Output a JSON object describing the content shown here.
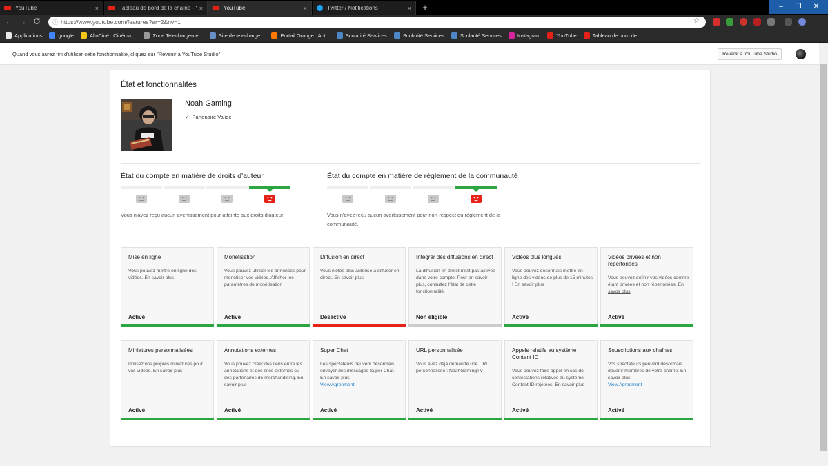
{
  "browser": {
    "tabs": [
      {
        "label": "YouTube",
        "icon": "youtube-icon",
        "close": "×"
      },
      {
        "label": "Tableau de bord de la chaîne - Y",
        "icon": "youtube-icon",
        "close": "×"
      },
      {
        "label": "YouTube",
        "icon": "youtube-icon",
        "close": "×"
      },
      {
        "label": "Twitter / Notifications",
        "icon": "twitter-icon",
        "close": "×"
      }
    ],
    "new_tab": "+",
    "window_controls": [
      "–",
      "❐",
      "✕"
    ],
    "url": "https://www.youtube.com/features?ar=2&nv=1",
    "back": "←",
    "forward": "→",
    "reload": "C",
    "star": "☆",
    "bookmarks": [
      {
        "label": "Applications",
        "color": "#e8e8e8"
      },
      {
        "label": "google",
        "color": "#4285f4"
      },
      {
        "label": "AlloCiné : Cinéma,...",
        "color": "#f5c518"
      },
      {
        "label": "Zone Telechargeme...",
        "color": "#999999"
      },
      {
        "label": "Site de telecharge...",
        "color": "#6a8ec7"
      },
      {
        "label": "Portail Orange : Act...",
        "color": "#ff7900"
      },
      {
        "label": "Scolarité Services",
        "color": "#4d87c7"
      },
      {
        "label": "Scolarité Services",
        "color": "#4d87c7"
      },
      {
        "label": "Scolarité Services",
        "color": "#4d87c7"
      },
      {
        "label": "Instagram",
        "color": "#d6249f"
      },
      {
        "label": "YouTube",
        "color": "#e62117"
      },
      {
        "label": "Tableau de bord de...",
        "color": "#e62117"
      }
    ]
  },
  "notice": {
    "text": "Quand vous aurez fini d'utiliser cette fonctionnalité, cliquez sur \"Revenir à YouTube Studio\"",
    "button": "Revenir à YouTube Studio"
  },
  "panel": {
    "title": "État et fonctionnalités",
    "channel_name": "Noah Gaming",
    "verified_label": "Partenaire Validé",
    "verified_check": "✓"
  },
  "copyright": {
    "title": "État du compte en matière de droits d'auteur",
    "strikes_active": 0,
    "desc": "Vous n'avez reçu aucun avertissement pour atteinte aux droits d'auteur."
  },
  "community": {
    "title": "État du compte en matière de règlement de la communauté",
    "strikes_active": 0,
    "desc": "Vous n'avez reçu aucun avertissement pour non-respect du règlement de la communauté."
  },
  "colors": {
    "active": "#2ba640",
    "disabled": "#e62117",
    "ineligible": "#cccccc"
  },
  "cards_row1": [
    {
      "title": "Mise en ligne",
      "desc": "Vous pouvez mettre en ligne des vidéos. ",
      "link": "En savoir plus",
      "agree": "",
      "status": "Activé",
      "state": "active"
    },
    {
      "title": "Monétisation",
      "desc": "Vous pouvez utiliser les annonces pour monétiser vos vidéos. ",
      "link": "Afficher les paramètres de monétisation",
      "agree": "",
      "status": "Activé",
      "state": "active"
    },
    {
      "title": "Diffusion en direct",
      "desc": "Vous n'êtes plus autorisé à diffuser en direct. ",
      "link": "En savoir plus",
      "agree": "",
      "status": "Désactivé",
      "state": "disabled"
    },
    {
      "title": "Intégrer des diffusions en direct",
      "desc": "La diffusion en direct n'est pas activée dans votre compte. Pour en savoir plus, consultez l'état de cette fonctionnalité.",
      "link": "",
      "agree": "",
      "status": "Non éligible",
      "state": "ineligible"
    },
    {
      "title": "Vidéos plus longues",
      "desc": "Vous pouvez désormais mettre en ligne des vidéos de plus de 15 minutes ! ",
      "link": "En savoir plus",
      "agree": "",
      "status": "Activé",
      "state": "active"
    },
    {
      "title": "Vidéos privées et non répertoriées",
      "desc": "Vous pouvez définir vos vidéos comme étant privées et non répertoriées. ",
      "link": "En savoir plus",
      "agree": "",
      "status": "Activé",
      "state": "active"
    }
  ],
  "cards_row2": [
    {
      "title": "Miniatures personnalisées",
      "desc": "Utilisez vos propres miniatures pour vos vidéos. ",
      "link": "En savoir plus",
      "agree": "",
      "status": "Activé",
      "state": "active"
    },
    {
      "title": "Annotations externes",
      "desc": "Vous pouvez créer des liens entre les annotations et des sites externes ou des partenaires de merchandising. ",
      "link": "En savoir plus",
      "agree": "",
      "status": "Activé",
      "state": "active"
    },
    {
      "title": "Super Chat",
      "desc": "Les spectateurs peuvent désormais envoyer des messages Super Chat. ",
      "link": "En savoir plus",
      "agree": "View Agreement",
      "status": "Activé",
      "state": "active"
    },
    {
      "title": "URL personnalisée",
      "desc": "Vous avez déjà demandé une URL personnalisée : ",
      "link": "NoahGamingTV",
      "agree": "",
      "status": "Activé",
      "state": "active"
    },
    {
      "title": "Appels relatifs au système Content ID",
      "desc": "Vous pouvez faire appel en cas de contestations relatives au système Content ID rejetées. ",
      "link": "En savoir plus",
      "agree": "",
      "status": "Activé",
      "state": "active"
    },
    {
      "title": "Souscriptions aux chaînes",
      "desc": "Vos spectateurs peuvent désormais devenir membres de votre chaîne. ",
      "link": "En savoir plus",
      "agree": "View Agreement",
      "status": "Activé",
      "state": "active"
    }
  ]
}
